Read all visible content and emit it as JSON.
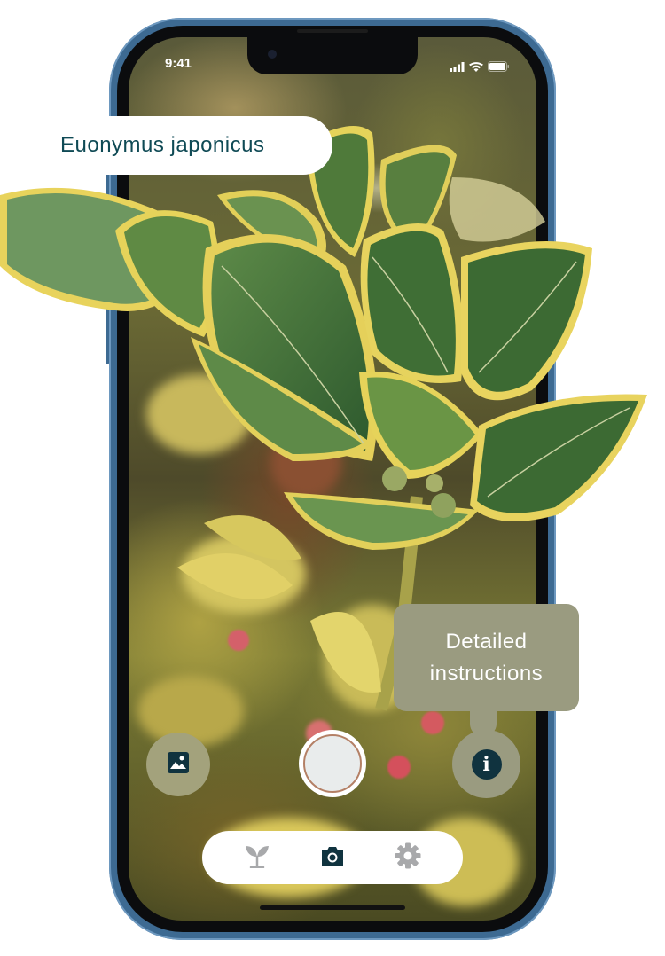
{
  "status_bar": {
    "time": "9:41",
    "icons": [
      "signal-icon",
      "wifi-icon",
      "battery-icon"
    ]
  },
  "identification": {
    "species_name": "Euonymus japonicus"
  },
  "tooltip": {
    "text": "Detailed instructions"
  },
  "camera_controls": {
    "gallery_icon": "image-icon",
    "shutter": "shutter-button",
    "info_icon": "info-icon"
  },
  "tab_bar": {
    "tabs": [
      {
        "icon": "sprout-icon",
        "active": false
      },
      {
        "icon": "camera-icon",
        "active": true
      },
      {
        "icon": "gear-icon",
        "active": false
      }
    ]
  },
  "colors": {
    "accent_dark": "#10333f",
    "species_text": "#0f4a55",
    "tooltip_bg": "#9a9b80",
    "phone_frame": "#3d6a92",
    "inactive_icon": "#a8a9ab"
  }
}
